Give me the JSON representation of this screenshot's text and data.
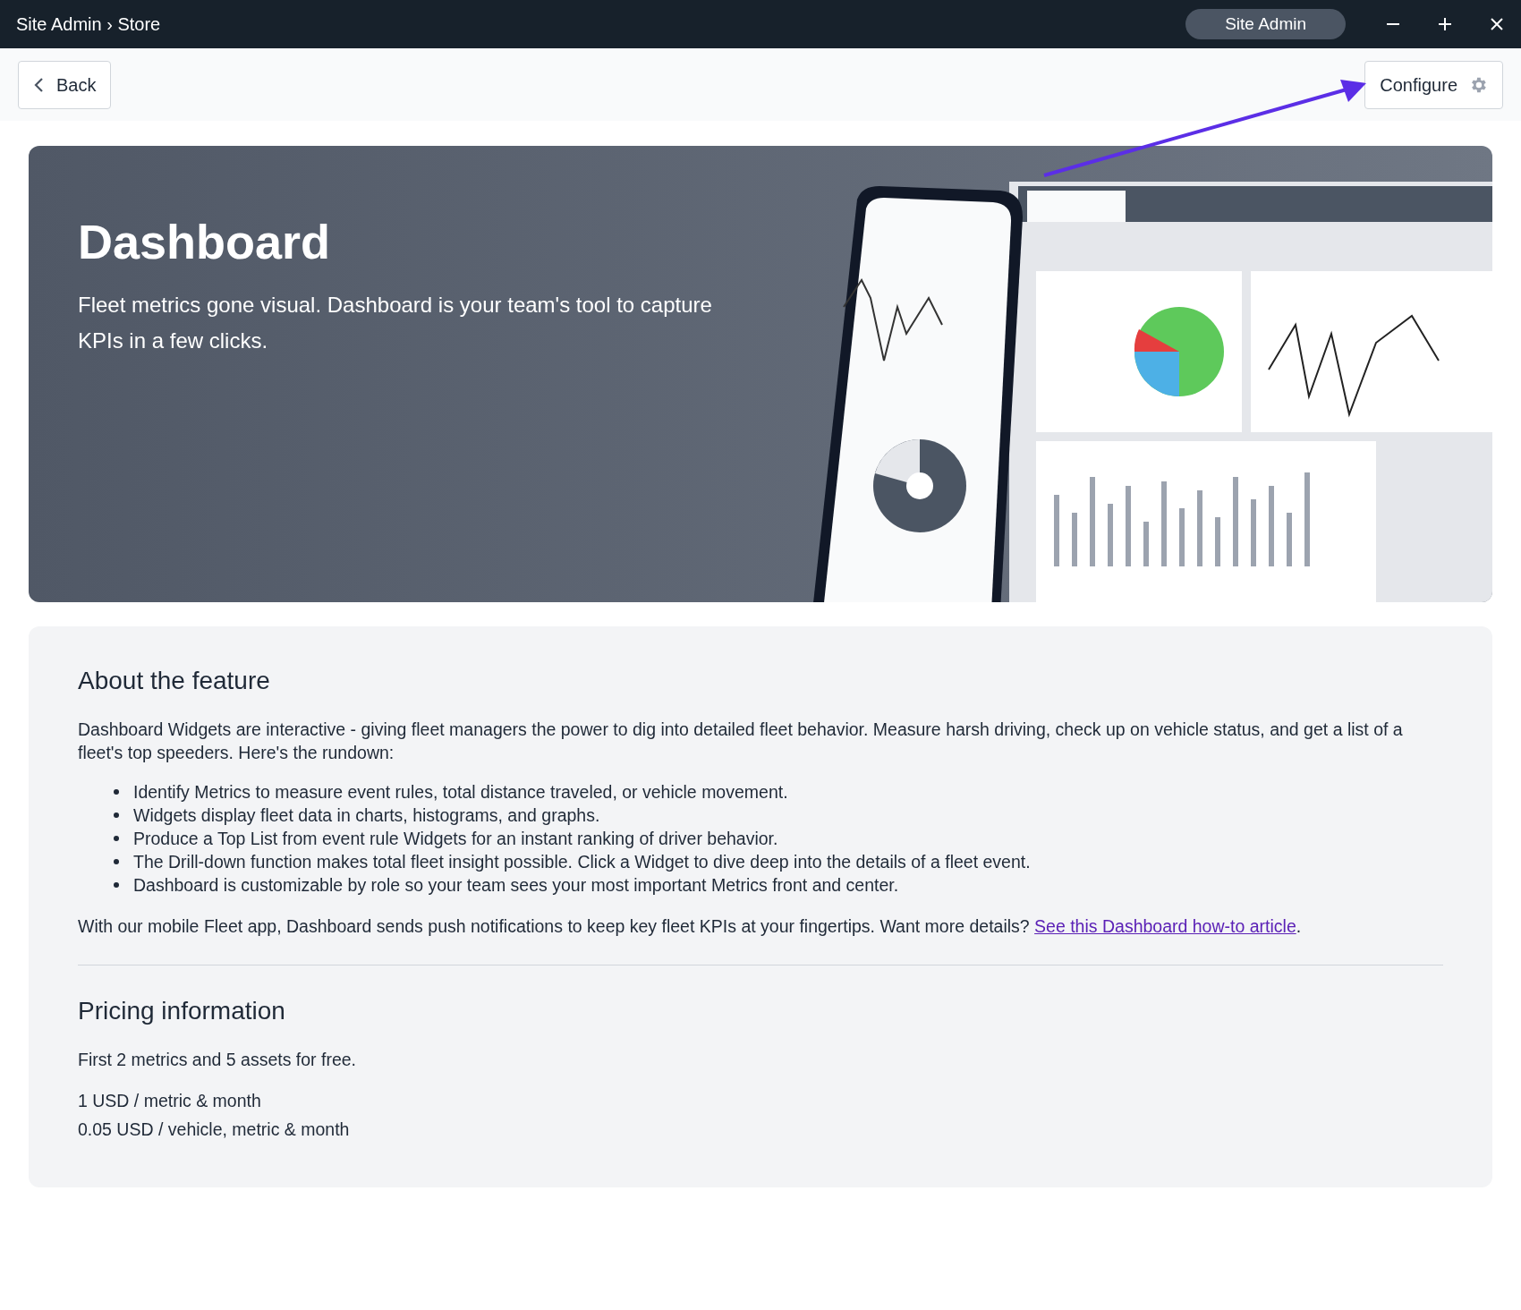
{
  "title_bar": {
    "title": "Site Admin › Store",
    "account": "Site Admin"
  },
  "toolbar": {
    "back": "Back",
    "configure": "Configure"
  },
  "hero": {
    "title": "Dashboard",
    "description": "Fleet metrics gone visual. Dashboard is your team's tool to capture KPIs in a few clicks."
  },
  "about": {
    "heading": "About the feature",
    "intro": "Dashboard Widgets are interactive - giving fleet managers the power to dig into detailed fleet behavior. Measure harsh driving, check up on vehicle status, and get a list of a fleet's top speeders. Here's the rundown:",
    "bullets": [
      "Identify Metrics to measure event rules, total distance traveled, or vehicle movement.",
      "Widgets display fleet data in charts, histograms, and graphs.",
      "Produce a Top List from event rule Widgets for an instant ranking of driver behavior.",
      "The Drill-down function makes total fleet insight possible. Click a Widget to dive deep into the details of a fleet event.",
      "Dashboard is customizable by role so your team sees your most important Metrics front and center."
    ],
    "closing": {
      "text": "With our mobile Fleet app, Dashboard sends push notifications to keep key fleet KPIs at your fingertips. Want more details? ",
      "link": "See this Dashboard how-to article",
      "end": "."
    }
  },
  "pricing": {
    "heading": "Pricing information",
    "lines": [
      "First 2 metrics and 5 assets for free.",
      "1 USD / metric & month",
      "0.05 USD / vehicle, metric & month"
    ]
  }
}
